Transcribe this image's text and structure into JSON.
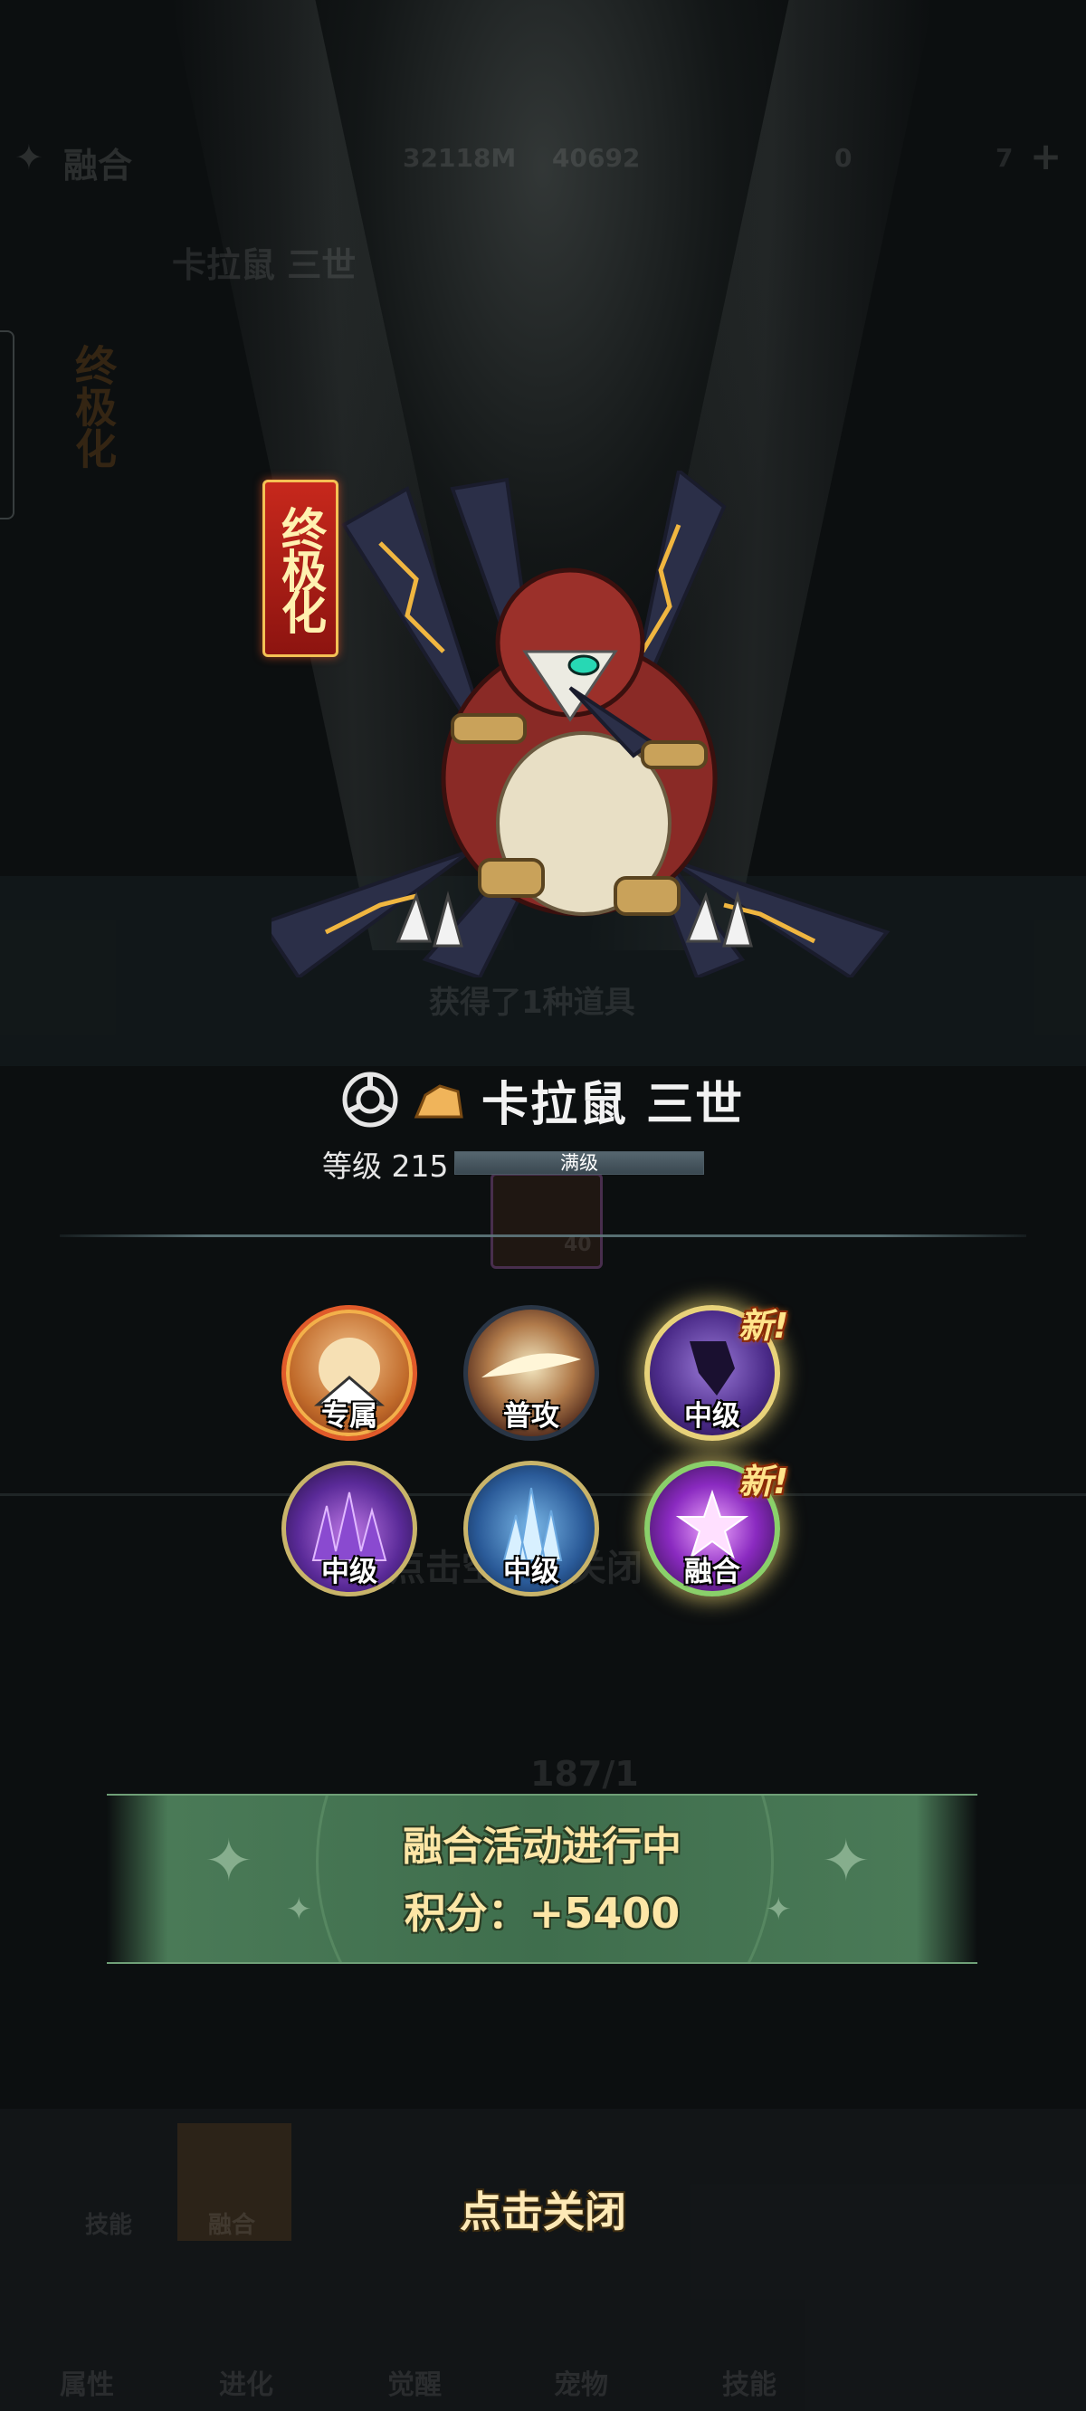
{
  "background": {
    "top_bar": {
      "mode": "融合",
      "currency_1": "32118M",
      "currency_2": "40692",
      "gem_count": "0",
      "ticket_count": "7"
    },
    "hero": {
      "name": "卡拉鼠 三世",
      "tier": "终极化"
    },
    "reward_text": "获得了1种道具",
    "reward_item_count": "40",
    "hint_text": "点击空白处关闭",
    "progress": "187/1",
    "tabs": [
      "技能",
      "融合"
    ],
    "nav": [
      "属性",
      "进化",
      "觉醒",
      "宠物",
      "技能"
    ]
  },
  "popup": {
    "tier_badge": "终极化",
    "name": "卡拉鼠 三世",
    "level_label": "等级 215",
    "level_fill": 1.0,
    "level_status": "满级",
    "skills": [
      {
        "label": "专属",
        "icon": "exclusive-skill-icon",
        "is_new": false
      },
      {
        "label": "普攻",
        "icon": "normal-attack-icon",
        "is_new": false
      },
      {
        "label": "中级",
        "icon": "shadow-kick-icon",
        "is_new": true,
        "new_text": "新!"
      },
      {
        "label": "中级",
        "icon": "purple-spikes-icon",
        "is_new": false
      },
      {
        "label": "中级",
        "icon": "ice-crystal-icon",
        "is_new": false
      },
      {
        "label": "融合",
        "icon": "fusion-star-icon",
        "is_new": true,
        "new_text": "新!"
      }
    ],
    "event_title": "融合活动进行中",
    "event_score": "积分：+5400",
    "close_text": "点击关闭"
  },
  "colors": {
    "accent_gold": "#fde6a6",
    "banner_green": "#3f6e4d",
    "badge_red": "#c7281c"
  }
}
